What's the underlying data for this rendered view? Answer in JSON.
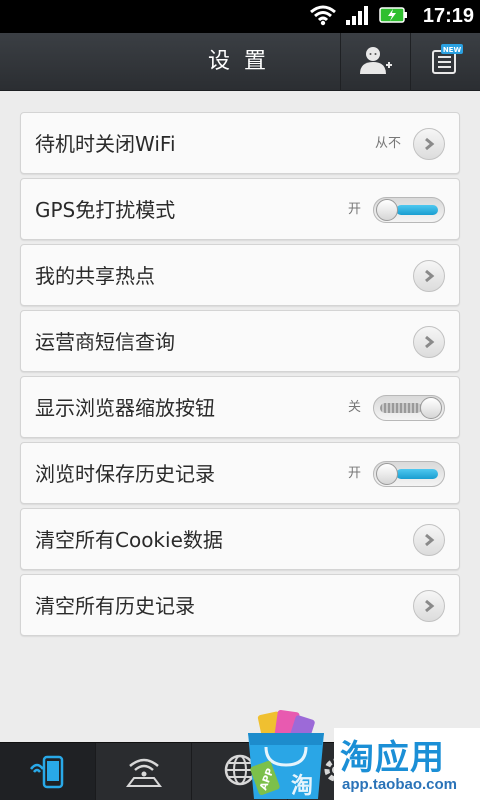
{
  "status_bar": {
    "time": "17:19",
    "icons": [
      "wifi-icon",
      "signal-icon",
      "battery-charging-icon"
    ]
  },
  "header": {
    "title": "设置",
    "actions": [
      "add-user-icon",
      "menu-new-icon"
    ],
    "new_badge": "NEW"
  },
  "settings": [
    {
      "label": "待机时关闭WiFi",
      "value": "从不",
      "control": "chevron"
    },
    {
      "label": "GPS免打扰模式",
      "value": "开",
      "control": "toggle",
      "on": true
    },
    {
      "label": "我的共享热点",
      "value": "",
      "control": "chevron"
    },
    {
      "label": "运营商短信查询",
      "value": "",
      "control": "chevron"
    },
    {
      "label": "显示浏览器缩放按钮",
      "value": "关",
      "control": "toggle",
      "on": false
    },
    {
      "label": "浏览时保存历史记录",
      "value": "开",
      "control": "toggle",
      "on": true
    },
    {
      "label": "清空所有Cookie数据",
      "value": "",
      "control": "chevron"
    },
    {
      "label": "清空所有历史记录",
      "value": "",
      "control": "chevron"
    }
  ],
  "bottom_nav": [
    {
      "icon": "phone-wifi-icon",
      "active": true
    },
    {
      "icon": "hotspot-icon",
      "active": false
    },
    {
      "icon": "globe-icon",
      "active": false
    },
    {
      "icon": "settings-icon",
      "active": false
    },
    {
      "icon": "search-icon",
      "active": false
    }
  ],
  "ad": {
    "title": "淘应用",
    "url": "app.taobao.com",
    "bag_label": "APP",
    "bag_char": "淘"
  },
  "colors": {
    "accent": "#1a9ed0",
    "titlebar": "#33363a",
    "background": "#ececec",
    "ad_blue": "#1b8fd6"
  }
}
